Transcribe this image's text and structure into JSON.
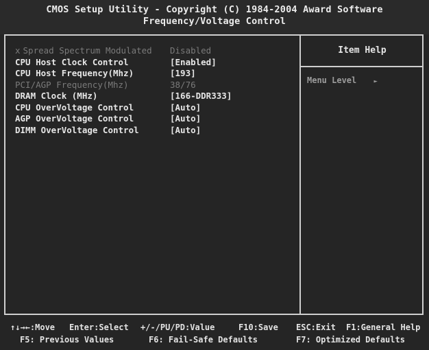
{
  "header": {
    "line1": "CMOS Setup Utility - Copyright (C) 1984-2004 Award Software",
    "line2": "Frequency/Voltage Control"
  },
  "settings": [
    {
      "label": "Spread Spectrum Modulated",
      "value": "Disabled",
      "disabled": true,
      "marker": "x"
    },
    {
      "label": "CPU Host Clock Control",
      "value": "[Enabled]",
      "disabled": false
    },
    {
      "label": "CPU Host Frequency(Mhz)",
      "value": "[193]",
      "disabled": false
    },
    {
      "label": "PCI/AGP Frequency(Mhz)",
      "value": "38/76",
      "disabled": true
    },
    {
      "label": "DRAM Clock (MHz)",
      "value": "[166-DDR333]",
      "disabled": false
    },
    {
      "label": "CPU OverVoltage Control",
      "value": "[Auto]",
      "disabled": false
    },
    {
      "label": "AGP OverVoltage Control",
      "value": "[Auto]",
      "disabled": false
    },
    {
      "label": "DIMM OverVoltage Control",
      "value": "[Auto]",
      "disabled": false
    }
  ],
  "help": {
    "title": "Item Help",
    "menu_level": "Menu Level",
    "menu_level_arrow": "►"
  },
  "footer": {
    "move": "↑↓→←:Move",
    "select": "Enter:Select",
    "value": "+/-/PU/PD:Value",
    "save": "F10:Save",
    "exit": "ESC:Exit",
    "general_help": "F1:General Help",
    "previous": "F5: Previous Values",
    "failsafe": "F6: Fail-Safe Defaults",
    "optimized": "F7: Optimized Defaults"
  },
  "colors": {
    "background": "#252525",
    "text": "#e6e6e6",
    "disabled_text": "#7a7a7a",
    "border": "#cfcfcf"
  }
}
